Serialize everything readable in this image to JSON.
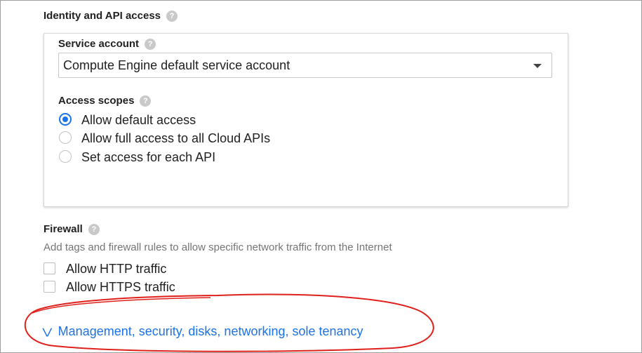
{
  "identity": {
    "title": "Identity and API access",
    "help_icon": "help-icon",
    "service_account": {
      "label": "Service account",
      "selected": "Compute Engine default service account"
    },
    "access_scopes": {
      "label": "Access scopes",
      "options": [
        {
          "label": "Allow default access",
          "checked": true
        },
        {
          "label": "Allow full access to all Cloud APIs",
          "checked": false
        },
        {
          "label": "Set access for each API",
          "checked": false
        }
      ]
    }
  },
  "firewall": {
    "title": "Firewall",
    "description": "Add tags and firewall rules to allow specific network traffic from the Internet",
    "options": [
      {
        "label": "Allow HTTP traffic",
        "checked": false
      },
      {
        "label": "Allow HTTPS traffic",
        "checked": false
      }
    ]
  },
  "management_link": {
    "label": "Management, security, disks, networking, sole tenancy",
    "icon": "double-chevron-down-icon"
  },
  "colors": {
    "accent": "#1a73e8",
    "annotation": "#e0201b"
  }
}
